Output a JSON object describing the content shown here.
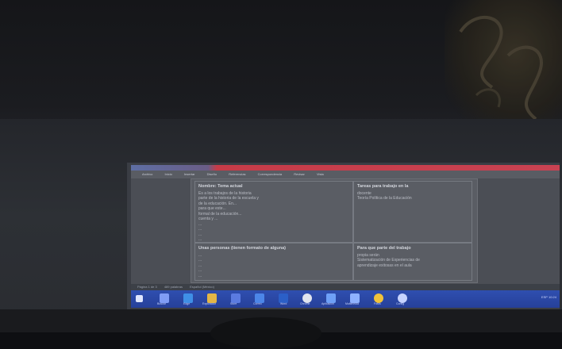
{
  "ribbon": {
    "tabs": [
      "Archivo",
      "Inicio",
      "Insertar",
      "Diseño",
      "Referencias",
      "Correspondencia",
      "Revisar",
      "Vista"
    ]
  },
  "table": {
    "cell_1_1": {
      "heading": "Nombre: Tema actual",
      "lines": [
        "Es a los trabajos de la historia",
        "parte de la historia de la escuela y",
        "de la educación. En...",
        "para que este...",
        "formal de la educación...",
        "cuenta y ...",
        "...",
        "...",
        "...",
        "..."
      ]
    },
    "cell_1_2": {
      "heading": "Tareas para trabajo en la",
      "lines": [
        "docente",
        "",
        "Teoría Política de la Educación"
      ]
    },
    "cell_2_1": {
      "heading": "Unas personas (tienen formato de alguna)",
      "lines": [
        "...",
        "...",
        "...",
        "...",
        "..."
      ]
    },
    "cell_2_2": {
      "heading": "Para que parte del trabajo",
      "lines": [
        "propia serán",
        "",
        "Sistematización de Experiencias de",
        "aprendizaje exitosas en el aula"
      ]
    }
  },
  "status_bar": {
    "page": "Página 1 de 3",
    "words": "489 palabras",
    "language": "Español (México)"
  },
  "taskbar": {
    "items": [
      {
        "icon": "start-icon",
        "label": ""
      },
      {
        "icon": "search-icon",
        "label": "Buscar"
      },
      {
        "icon": "edge-icon",
        "label": "Edge"
      },
      {
        "icon": "folder-icon",
        "label": "Explorador"
      },
      {
        "icon": "store-icon",
        "label": "Store"
      },
      {
        "icon": "mail-icon",
        "label": "Correo"
      },
      {
        "icon": "word-icon",
        "label": "Word"
      },
      {
        "icon": "chrome-icon",
        "label": "Chrome"
      },
      {
        "icon": "app-icon",
        "label": "Aplicación"
      },
      {
        "icon": "media-icon",
        "label": "Multimedia"
      },
      {
        "icon": "photo-icon",
        "label": "Fotos"
      },
      {
        "icon": "settings-icon",
        "label": "Config"
      }
    ],
    "tray": "ESP  10:24"
  },
  "colors": {
    "title_bar": "#c94252",
    "taskbar": "#26409a"
  }
}
